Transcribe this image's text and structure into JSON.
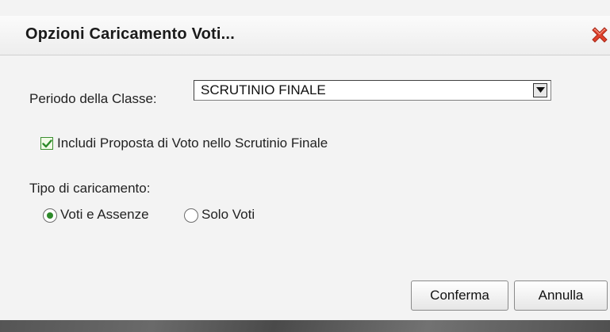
{
  "dialog": {
    "title": "Opzioni Caricamento Voti...",
    "close_icon": "close-icon"
  },
  "form": {
    "period_label": "Periodo della Classe:",
    "period_selected": "SCRUTINIO FINALE",
    "include_checkbox_label": "Includi Proposta di Voto nello Scrutinio Finale",
    "include_checked": true,
    "tipo_label": "Tipo di caricamento:",
    "radio_options": [
      {
        "label": "Voti e Assenze",
        "selected": true
      },
      {
        "label": "Solo Voti",
        "selected": false
      }
    ]
  },
  "buttons": {
    "confirm_label": "Conferma",
    "cancel_label": "Annulla"
  },
  "colors": {
    "close": "#e0412c",
    "check": "#2d8a2a"
  }
}
